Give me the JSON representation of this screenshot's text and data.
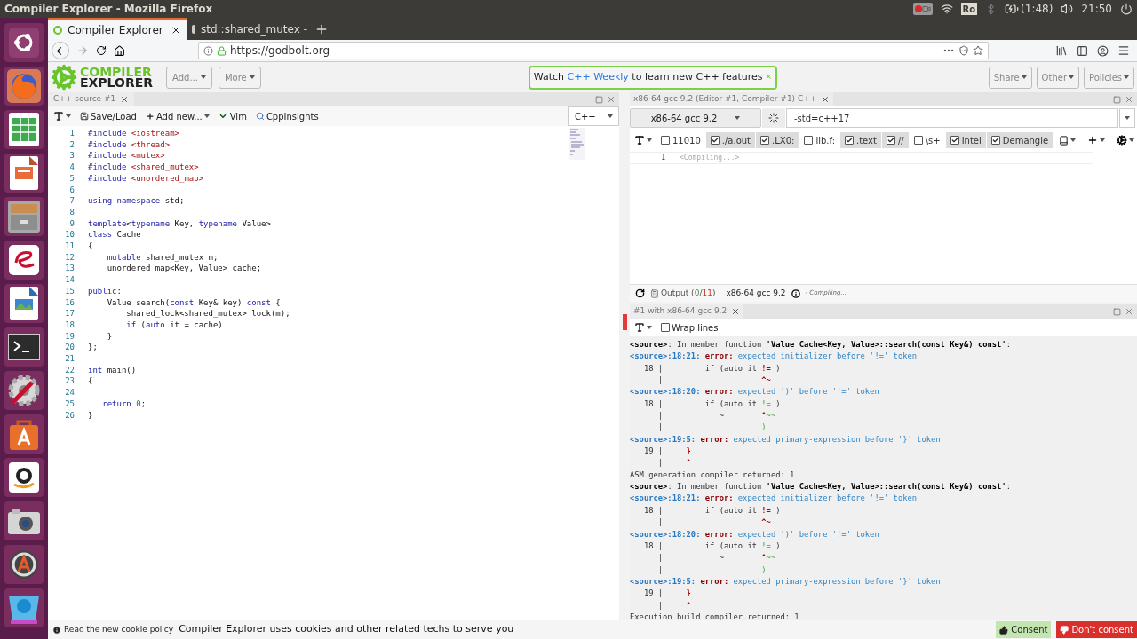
{
  "window": {
    "title": "Compiler Explorer - Mozilla Firefox"
  },
  "system_tray": {
    "keyboard": "Ro",
    "battery": "(1:48)",
    "time": "21:50"
  },
  "browser_tabs": [
    {
      "label": "Compiler Explorer",
      "selected": true
    },
    {
      "label": "std::shared_mutex -",
      "selected": false
    }
  ],
  "address_bar": {
    "url": "https://godbolt.org"
  },
  "header": {
    "logo": [
      "COMPILER",
      "EXPLORER"
    ],
    "menus": [
      "Add...",
      "More"
    ],
    "notice": {
      "before": "Watch ",
      "link": "C++ Weekly",
      "after": " to learn new C++ features",
      "close": "×"
    },
    "right_menus": [
      "Share",
      "Other",
      "Policies"
    ]
  },
  "editor": {
    "tab": "C++ source #1",
    "toolbar": [
      "Save/Load",
      "Add new...",
      "Vim",
      "CppInsights"
    ],
    "language": "C++",
    "lines": [
      {
        "n": "1",
        "tokens": [
          {
            "text": "#include",
            "kind": "k"
          },
          {
            "text": " <iostream>",
            "kind": "s"
          }
        ]
      },
      {
        "n": "2",
        "tokens": [
          {
            "text": "#include",
            "kind": "k"
          },
          {
            "text": " <thread>",
            "kind": "s"
          }
        ]
      },
      {
        "n": "3",
        "tokens": [
          {
            "text": "#include",
            "kind": "k"
          },
          {
            "text": " <mutex>",
            "kind": "s"
          }
        ]
      },
      {
        "n": "4",
        "tokens": [
          {
            "text": "#include",
            "kind": "k"
          },
          {
            "text": " <shared_mutex>",
            "kind": "s"
          }
        ]
      },
      {
        "n": "5",
        "tokens": [
          {
            "text": "#include",
            "kind": "k"
          },
          {
            "text": " <unordered_map>",
            "kind": "s"
          }
        ]
      },
      {
        "n": "6"
      },
      {
        "n": "7",
        "tokens": [
          {
            "text": "using namespace",
            "kind": "k"
          },
          {
            "text": " std;",
            "kind": "p"
          }
        ]
      },
      {
        "n": "8"
      },
      {
        "n": "9",
        "tokens": [
          {
            "text": "template",
            "kind": "k"
          },
          {
            "text": "<",
            "kind": "p"
          },
          {
            "text": "typename",
            "kind": "k"
          },
          {
            "text": " Key, ",
            "kind": "p"
          },
          {
            "text": "typename",
            "kind": "k"
          },
          {
            "text": " Value>",
            "kind": "p"
          }
        ]
      },
      {
        "n": "10",
        "tokens": [
          {
            "text": "class",
            "kind": "k"
          },
          {
            "text": " Cache",
            "kind": "p"
          }
        ]
      },
      {
        "n": "11",
        "tokens": [
          {
            "text": "{",
            "kind": "p"
          }
        ]
      },
      {
        "n": "12",
        "tokens": [
          {
            "text": "    mutable",
            "kind": "k"
          },
          {
            "text": " shared_mutex m;",
            "kind": "p"
          }
        ]
      },
      {
        "n": "13",
        "tokens": [
          {
            "text": "    unordered_map<Key, Value> cache;",
            "kind": "p"
          }
        ]
      },
      {
        "n": "14"
      },
      {
        "n": "15",
        "tokens": [
          {
            "text": "public",
            "kind": "k"
          },
          {
            "text": ":",
            "kind": "p"
          }
        ]
      },
      {
        "n": "16",
        "tokens": [
          {
            "text": "    Value search(",
            "kind": "p"
          },
          {
            "text": "const",
            "kind": "k"
          },
          {
            "text": " Key& key) ",
            "kind": "p"
          },
          {
            "text": "const",
            "kind": "k"
          },
          {
            "text": " {",
            "kind": "p"
          }
        ]
      },
      {
        "n": "17",
        "tokens": [
          {
            "text": "        shared_lock<shared_mutex> lock(m);",
            "kind": "p"
          }
        ]
      },
      {
        "n": "18",
        "tokens": [
          {
            "text": "        if",
            "kind": "k"
          },
          {
            "text": " (",
            "kind": "p"
          },
          {
            "text": "auto",
            "kind": "k"
          },
          {
            "text": " it = cache)",
            "kind": "p"
          }
        ]
      },
      {
        "n": "19",
        "tokens": [
          {
            "text": "    }",
            "kind": "p"
          }
        ]
      },
      {
        "n": "20",
        "tokens": [
          {
            "text": "};",
            "kind": "p"
          }
        ]
      },
      {
        "n": "21"
      },
      {
        "n": "22",
        "tokens": [
          {
            "text": "int",
            "kind": "k"
          },
          {
            "text": " main()",
            "kind": "p"
          }
        ]
      },
      {
        "n": "23",
        "tokens": [
          {
            "text": "{",
            "kind": "p"
          }
        ]
      },
      {
        "n": "24"
      },
      {
        "n": "25",
        "tokens": [
          {
            "text": "   return",
            "kind": "k"
          },
          {
            "text": " 0",
            "kind": "n"
          },
          {
            "text": ";",
            "kind": "p"
          }
        ]
      },
      {
        "n": "26",
        "tokens": [
          {
            "text": "}",
            "kind": "p"
          }
        ]
      }
    ]
  },
  "compiler": {
    "tab": "x86-64 gcc 9.2 (Editor #1, Compiler #1) C++",
    "name": "x86-64 gcc 9.2",
    "options": "-std=c++17",
    "filters": [
      {
        "label": "11010",
        "checked": false
      },
      {
        "label": "./a.out",
        "checked": true
      },
      {
        "label": ".LX0:",
        "checked": true
      },
      {
        "label": "lib.f:",
        "checked": false
      },
      {
        "label": ".text",
        "checked": true
      },
      {
        "label": "//",
        "checked": true
      },
      {
        "label": "\\s+",
        "checked": false
      },
      {
        "label": "Intel",
        "checked": true
      },
      {
        "label": "Demangle",
        "checked": true
      }
    ],
    "asm_lines": [
      {
        "n": "1",
        "text": "<Compiling...>"
      }
    ],
    "status": {
      "output": [
        {
          "text": "Output (",
          "kind": "p"
        },
        {
          "text": "0",
          "kind": "ok"
        },
        {
          "text": "/",
          "kind": "p"
        },
        {
          "text": "11",
          "kind": "fail"
        },
        {
          "text": ")",
          "kind": "p"
        }
      ],
      "compiler": "x86-64 gcc 9.2",
      "state": "- Compiling..."
    }
  },
  "output": {
    "tab": "#1 with x86-64 gcc 9.2",
    "wrap_lines": {
      "label": "Wrap lines",
      "checked": false
    },
    "lines": [
      [
        {
          "text": "<source>",
          "kind": "b"
        },
        {
          "text": ": In member function ",
          "kind": "p"
        },
        {
          "text": "'Value Cache<Key, Value>::search(const Key&) const'",
          "kind": "b"
        },
        {
          "text": ":",
          "kind": "p"
        }
      ],
      [
        {
          "text": "<source>:18:21:",
          "kind": "loc"
        },
        {
          "text": " error:",
          "kind": "err"
        },
        {
          "text": " expected initializer before '!=' token",
          "kind": "m"
        }
      ],
      [
        {
          "text": "   18 |         if (auto it ",
          "kind": "p"
        },
        {
          "text": "!=",
          "kind": "r"
        },
        {
          "text": " )",
          "kind": "p"
        }
      ],
      [
        {
          "text": "      |",
          "kind": "p"
        },
        {
          "text": "                     ^~",
          "kind": "r"
        }
      ],
      [
        {
          "text": "<source>:18:20:",
          "kind": "loc"
        },
        {
          "text": " error:",
          "kind": "err"
        },
        {
          "text": " expected ')' before '!=' token",
          "kind": "m"
        }
      ],
      [
        {
          "text": "   18 |         if (auto it ",
          "kind": "p"
        },
        {
          "text": "!=",
          "kind": "g"
        },
        {
          "text": " )",
          "kind": "p"
        }
      ],
      [
        {
          "text": "      |            ~",
          "kind": "p"
        },
        {
          "text": "        ^",
          "kind": "r"
        },
        {
          "text": "~~",
          "kind": "g"
        }
      ],
      [
        {
          "text": "      |",
          "kind": "p"
        },
        {
          "text": "                     )",
          "kind": "g"
        }
      ],
      [
        {
          "text": "<source>:19:5:",
          "kind": "loc"
        },
        {
          "text": " error:",
          "kind": "err"
        },
        {
          "text": " expected primary-expression before '}' token",
          "kind": "m"
        }
      ],
      [
        {
          "text": "   19 |",
          "kind": "p"
        },
        {
          "text": "     }",
          "kind": "r"
        }
      ],
      [
        {
          "text": "      |",
          "kind": "p"
        },
        {
          "text": "     ^",
          "kind": "r"
        }
      ],
      [
        {
          "text": "ASM generation compiler returned: 1",
          "kind": "p"
        }
      ],
      [
        {
          "text": "<source>",
          "kind": "b"
        },
        {
          "text": ": In member function ",
          "kind": "p"
        },
        {
          "text": "'Value Cache<Key, Value>::search(const Key&) const'",
          "kind": "b"
        },
        {
          "text": ":",
          "kind": "p"
        }
      ],
      [
        {
          "text": "<source>:18:21:",
          "kind": "loc"
        },
        {
          "text": " error:",
          "kind": "err"
        },
        {
          "text": " expected initializer before '!=' token",
          "kind": "m"
        }
      ],
      [
        {
          "text": "   18 |         if (auto it ",
          "kind": "p"
        },
        {
          "text": "!=",
          "kind": "r"
        },
        {
          "text": " )",
          "kind": "p"
        }
      ],
      [
        {
          "text": "      |",
          "kind": "p"
        },
        {
          "text": "                     ^~",
          "kind": "r"
        }
      ],
      [
        {
          "text": "<source>:18:20:",
          "kind": "loc"
        },
        {
          "text": " error:",
          "kind": "err"
        },
        {
          "text": " expected ')' before '!=' token",
          "kind": "m"
        }
      ],
      [
        {
          "text": "   18 |         if (auto it ",
          "kind": "p"
        },
        {
          "text": "!=",
          "kind": "g"
        },
        {
          "text": " )",
          "kind": "p"
        }
      ],
      [
        {
          "text": "      |            ~",
          "kind": "p"
        },
        {
          "text": "        ^",
          "kind": "r"
        },
        {
          "text": "~~",
          "kind": "g"
        }
      ],
      [
        {
          "text": "      |",
          "kind": "p"
        },
        {
          "text": "                     )",
          "kind": "g"
        }
      ],
      [
        {
          "text": "<source>:19:5:",
          "kind": "loc"
        },
        {
          "text": " error:",
          "kind": "err"
        },
        {
          "text": " expected primary-expression before '}' token",
          "kind": "m"
        }
      ],
      [
        {
          "text": "   19 |",
          "kind": "p"
        },
        {
          "text": "     }",
          "kind": "r"
        }
      ],
      [
        {
          "text": "      |",
          "kind": "p"
        },
        {
          "text": "     ^",
          "kind": "r"
        }
      ],
      [
        {
          "text": "Execution build compiler returned: 1",
          "kind": "p"
        }
      ]
    ]
  },
  "cookie_bar": {
    "link": "Read the new cookie policy",
    "message": "Compiler Explorer uses cookies and other related techs to serve you",
    "buttons": [
      "Consent",
      "Don't consent"
    ]
  }
}
